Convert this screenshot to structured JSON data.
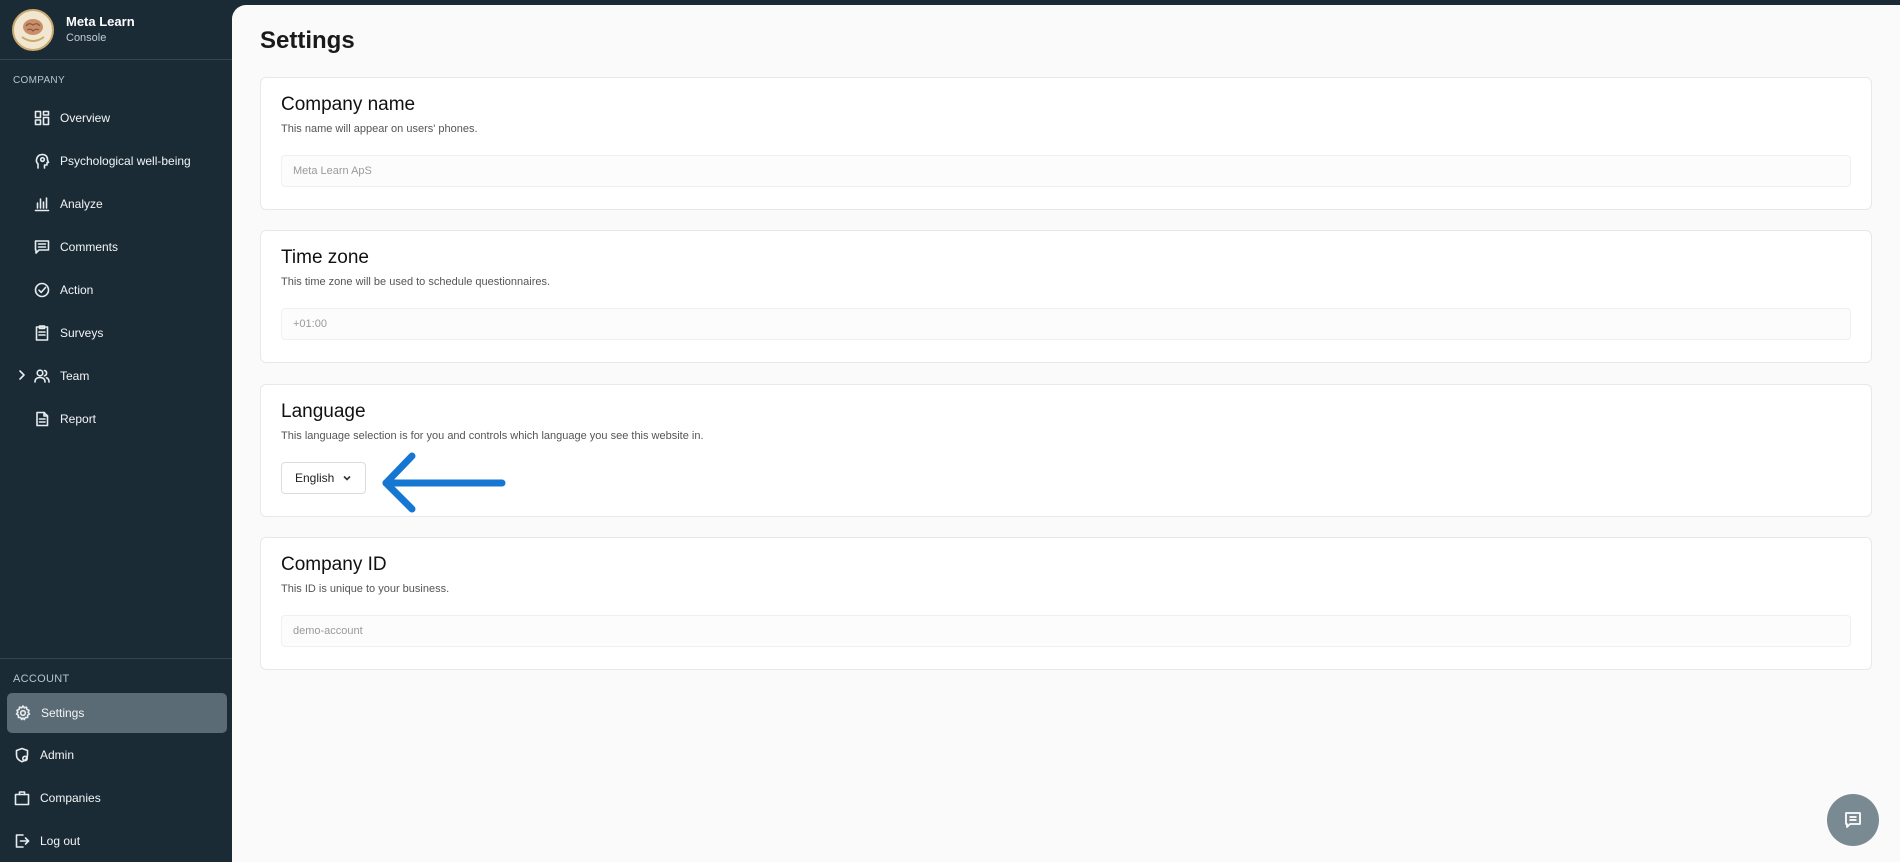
{
  "brand": {
    "title": "Meta Learn",
    "subtitle": "Console"
  },
  "sidebar": {
    "company_label": "COMPANY",
    "company_items": [
      {
        "label": "Overview",
        "icon": "grid-icon"
      },
      {
        "label": "Psychological well-being",
        "icon": "head-icon"
      },
      {
        "label": "Analyze",
        "icon": "bar-chart-icon"
      },
      {
        "label": "Comments",
        "icon": "comment-icon"
      },
      {
        "label": "Action",
        "icon": "check-circle-icon"
      },
      {
        "label": "Surveys",
        "icon": "clipboard-icon"
      },
      {
        "label": "Team",
        "icon": "users-icon"
      },
      {
        "label": "Report",
        "icon": "document-icon"
      }
    ],
    "account_label": "ACCOUNT",
    "account_items": [
      {
        "label": "Settings",
        "icon": "gear-icon",
        "active": true
      },
      {
        "label": "Admin",
        "icon": "shield-icon"
      },
      {
        "label": "Companies",
        "icon": "briefcase-icon"
      },
      {
        "label": "Log out",
        "icon": "logout-icon"
      }
    ]
  },
  "main": {
    "title": "Settings",
    "company_name": {
      "title": "Company name",
      "description": "This name will appear on users' phones.",
      "value": "Meta Learn ApS"
    },
    "time_zone": {
      "title": "Time zone",
      "description": "This time zone will be used to schedule questionnaires.",
      "value": "+01:00"
    },
    "language": {
      "title": "Language",
      "description": "This language selection is for you and controls which language you see this website in.",
      "selected": "English"
    },
    "company_id": {
      "title": "Company ID",
      "description": "This ID is unique to your business.",
      "value": "demo-account"
    }
  },
  "colors": {
    "sidebar_bg": "#1b2b35",
    "active_item": "#5a6b75",
    "annotation_arrow": "#1677d2",
    "chat_button": "#7a8a93"
  }
}
